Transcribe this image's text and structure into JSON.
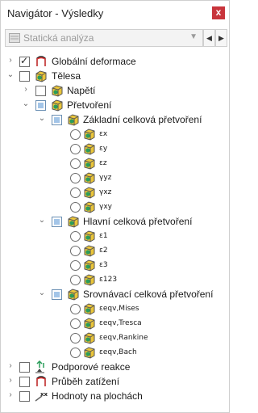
{
  "window": {
    "title": "Navigátor - Výsledky",
    "close": "x"
  },
  "toolbar": {
    "analysis_type": "Statická analýza",
    "prev": "◀",
    "next": "▶"
  },
  "tree": {
    "global_deformation": "Globální deformace",
    "solids": "Tělesa",
    "stress": "Napětí",
    "strain": "Přetvoření",
    "basic_total_strain": "Základní celková přetvoření",
    "basic_items": [
      "εx",
      "εy",
      "εz",
      "γyz",
      "γxz",
      "γxy"
    ],
    "principal_total_strain": "Hlavní celková přetvoření",
    "principal_items": [
      "ε1",
      "ε2",
      "ε3",
      "ε123"
    ],
    "equivalent_total_strain": "Srovnávací celková přetvoření",
    "equivalent_items": [
      "εeqv,Mises",
      "εeqv,Tresca",
      "εeqv,Rankine",
      "εeqv,Bach"
    ],
    "support_reactions": "Podporové reakce",
    "load_distribution": "Průběh zatížení",
    "surface_values": "Hodnoty na plochách"
  }
}
